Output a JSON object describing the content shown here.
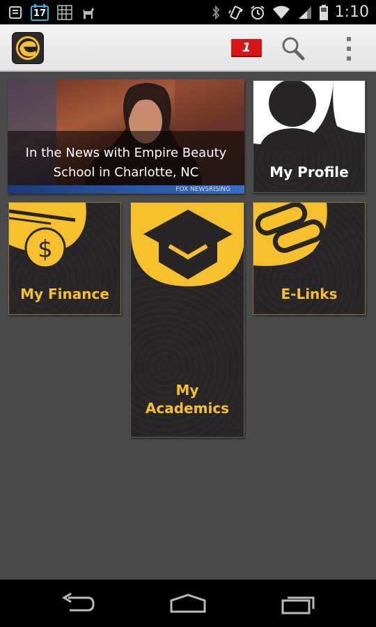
{
  "status_bar": {
    "calendar_day": "17",
    "clock": "1:10",
    "icons": [
      "notification-list-icon",
      "calendar-icon",
      "grid-icon",
      "deer-icon",
      "bluetooth-icon",
      "vibrate-icon",
      "alarm-icon",
      "wifi-icon",
      "signal-icon",
      "battery-icon"
    ]
  },
  "action_bar": {
    "logo_icon": "empire-logo-icon",
    "notification_count": "1",
    "search_icon": "search-icon",
    "menu_icon": "overflow-menu-icon"
  },
  "tiles": {
    "news": {
      "caption": "In the News with Empire Beauty School in Charlotte, NC",
      "ticker": "FOX NEWSRISING"
    },
    "profile": {
      "label": "My Profile"
    },
    "finance": {
      "label": "My Finance"
    },
    "academics": {
      "label_line1": "My",
      "label_line2": "Academics"
    },
    "elinks": {
      "label": "E-Links"
    }
  },
  "nav_bar": {
    "icons": [
      "back-icon",
      "home-icon",
      "recent-apps-icon"
    ]
  },
  "colors": {
    "accent_gold": "#f6c02c",
    "tile_bg": "#272525",
    "background": "#4a4a4a",
    "badge_red": "#d7151a"
  }
}
